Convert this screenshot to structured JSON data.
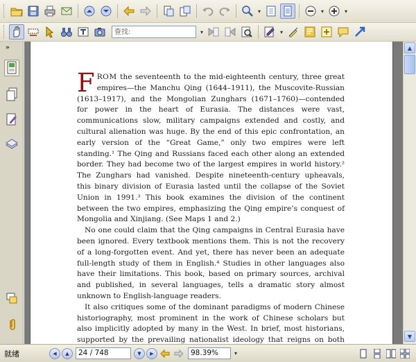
{
  "toolbar": {
    "find_placeholder": "查找:"
  },
  "status": {
    "ready_text": "就绪",
    "page_display": "24 / 748",
    "zoom_display": "98.39%"
  },
  "document": {
    "drop_cap": "F",
    "first_word": "ROM",
    "paragraphs": [
      "the seventeenth to the mid-eighteenth century, three great empires—the Manchu Qing (1644–1911), the Muscovite-Russian (1613–1917), and the Mongolian Zunghars (1671–1760)—contended for power in the heart of Eurasia. The distances were vast, communications slow, military campaigns extended and costly, and cultural alienation was huge. By the end of this epic confrontation, an early version of the “Great Game,” only two empires were left standing.¹ The Qing and Russians faced each other along an extended border. They had become two of the largest empires in world history.² The Zunghars had vanished. Despite nineteenth-century upheavals, this binary division of Eurasia lasted until the collapse of the Soviet Union in 1991.³ This book examines the division of the continent between the two empires, emphasizing the Qing empire’s conquest of Mongolia and Xinjiang. (See Maps 1 and 2.)",
      "No one could claim that the Qing campaigns in Central Eurasia have been ignored. Every textbook mentions them. This is not the recovery of a long-forgotten event. And yet, there has never been an adequate full-length study of them in English.⁴ Studies in other languages also have their limitations. This book, based on primary sources, archival and published, in several languages, tells a dramatic story almost unknown to English-language readers.",
      "It also critiques some of the dominant paradigms of modern Chinese historiography, most prominent in the work of Chinese scholars but also implicitly adopted by many in the West. In brief, most historians, supported by the prevailing nationalist ideology that reigns on both sides of the Tai"
    ]
  },
  "colors": {
    "drop_cap": "#8b1414",
    "doc_background": "#7a7a7a",
    "toolbar_background": "#ece9d8"
  },
  "icons": {
    "toolbar1": [
      "open-folder-icon",
      "save-icon",
      "print-icon",
      "email-icon",
      "page-up-icon",
      "page-down-icon",
      "back-icon",
      "forward-icon",
      "extract-pages-icon",
      "insert-pages-icon",
      "undo-icon",
      "redo-icon",
      "zoom-icon",
      "actual-size-icon",
      "fit-page-icon",
      "zoom-out-icon",
      "zoom-in-icon"
    ],
    "toolbar2": [
      "hand-tool-icon",
      "snapshot-icon",
      "select-arrow-icon",
      "binoculars-icon",
      "typewriter-icon",
      "camera-icon",
      "find-prev-icon",
      "find-next-icon",
      "search-icon",
      "comment-tool-icon",
      "highlighter-icon",
      "text-box-icon",
      "note-icon",
      "arrow-tool-icon"
    ],
    "sidebar": [
      "bookmarks-icon",
      "pages-icon",
      "comments-icon",
      "layers-icon",
      "attachment-note-icon",
      "paperclip-icon"
    ]
  }
}
